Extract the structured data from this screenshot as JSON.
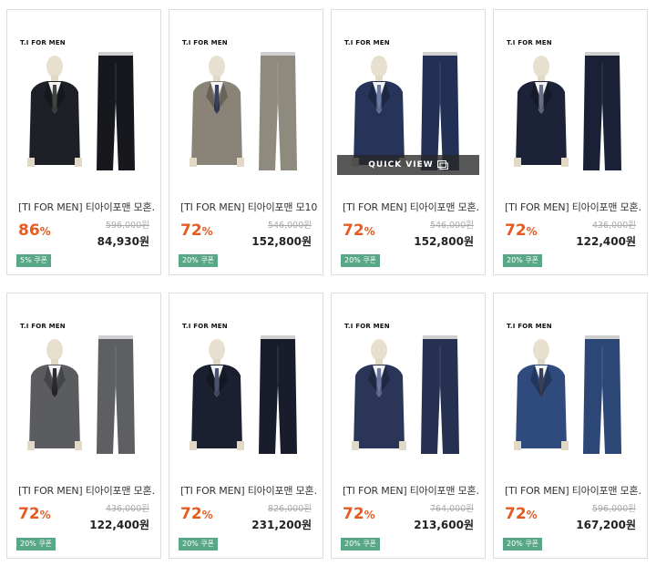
{
  "products": [
    {
      "brand": "T.I FOR MEN",
      "title": "[TI FOR MEN] 티아이포맨 모혼…",
      "original_price": "596,000원",
      "discount": "86",
      "price": "84,930원",
      "coupon": "5% 쿠폰",
      "suit_color": "#1d2026",
      "pants_color": "#16181d",
      "tie_color": "#444",
      "quick_view": false
    },
    {
      "brand": "T.I FOR MEN",
      "title": "[TI FOR MEN] 티아이포맨 모10…",
      "original_price": "546,000원",
      "discount": "72",
      "price": "152,800원",
      "coupon": "20% 쿠폰",
      "suit_color": "#8a8478",
      "pants_color": "#8f8a7e",
      "tie_color": "#3a3f5c",
      "quick_view": false
    },
    {
      "brand": "T.I FOR MEN",
      "title": "[TI FOR MEN] 티아이포맨 모혼…",
      "original_price": "546,000원",
      "discount": "72",
      "price": "152,800원",
      "coupon": "20% 쿠폰",
      "suit_color": "#27345a",
      "pants_color": "#223055",
      "tie_color": "#6b7aa0",
      "quick_view": true,
      "quick_view_label": "QUICK VIEW"
    },
    {
      "brand": "T.I FOR MEN",
      "title": "[TI FOR MEN] 티아이포맨 모혼…",
      "original_price": "436,000원",
      "discount": "72",
      "price": "122,400원",
      "coupon": "20% 쿠폰",
      "suit_color": "#1c2238",
      "pants_color": "#1a2036",
      "tie_color": "#6a6f85",
      "quick_view": false
    },
    {
      "brand": "T.I FOR MEN",
      "title": "[TI FOR MEN] 티아이포맨 모혼…",
      "original_price": "436,000원",
      "discount": "72",
      "price": "122,400원",
      "coupon": "20% 쿠폰",
      "suit_color": "#5a5c60",
      "pants_color": "#5d5f63",
      "tie_color": "#2a2a2e",
      "quick_view": false
    },
    {
      "brand": "T.I FOR MEN",
      "title": "[TI FOR MEN] 티아이포맨 모혼…",
      "original_price": "826,000원",
      "discount": "72",
      "price": "231,200원",
      "coupon": "20% 쿠폰",
      "suit_color": "#1b2030",
      "pants_color": "#191d2b",
      "tie_color": "#4a5370",
      "quick_view": false
    },
    {
      "brand": "T.I FOR MEN",
      "title": "[TI FOR MEN] 티아이포맨 모혼…",
      "original_price": "764,000원",
      "discount": "72",
      "price": "213,600원",
      "coupon": "20% 쿠폰",
      "suit_color": "#2a3558",
      "pants_color": "#263152",
      "tie_color": "#6a78a0",
      "quick_view": false
    },
    {
      "brand": "T.I FOR MEN",
      "title": "[TI FOR MEN] 티아이포맨 모혼…",
      "original_price": "596,000원",
      "discount": "72",
      "price": "167,200원",
      "coupon": "20% 쿠폰",
      "suit_color": "#2f4a7c",
      "pants_color": "#2c4676",
      "tie_color": "#3a3f55",
      "quick_view": false
    }
  ]
}
